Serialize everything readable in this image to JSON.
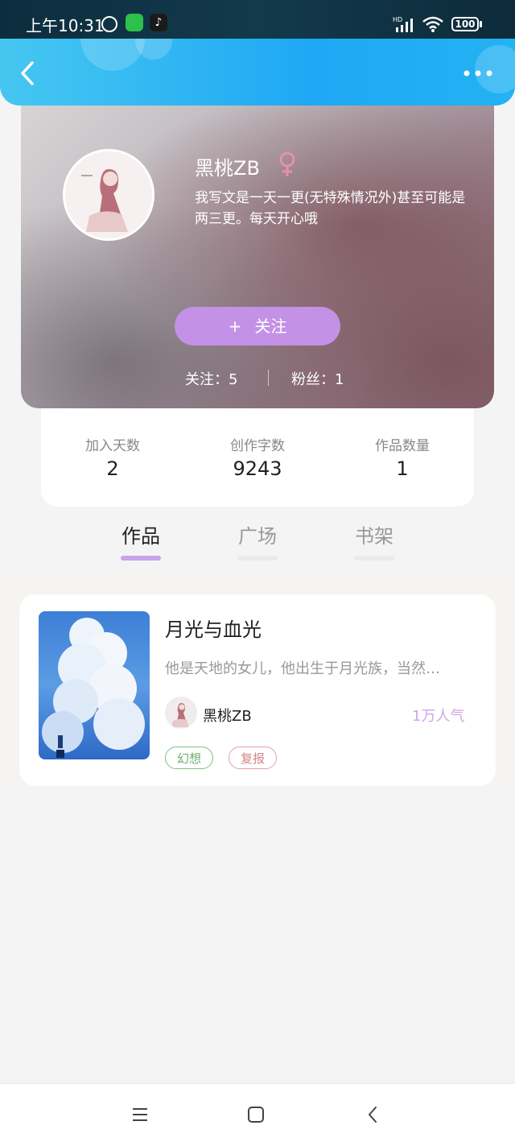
{
  "status_bar": {
    "time": "上午10:31",
    "battery": "100",
    "network": "HD",
    "icons": [
      "alarm-icon",
      "wechat-icon",
      "tiktok-icon",
      "signal-icon",
      "wifi-icon",
      "battery-icon"
    ]
  },
  "app_bar": {
    "back_icon": "chevron-left-icon",
    "more_icon": "more-dots-icon",
    "colors": {
      "start": "#46c7f1",
      "end": "#23b2f3"
    }
  },
  "profile": {
    "username": "黑桃ZB",
    "gender_symbol": "♀",
    "bio": "我写文是一天一更(无特殊情况外)甚至可能是两三更。每天开心哦",
    "follow_plus": "+",
    "follow_label": "关注",
    "following_text": "关注：5",
    "fans_text": "粉丝：1",
    "accent_color": "#c391e6"
  },
  "stats": {
    "items": [
      {
        "label": "加入天数",
        "value": "2"
      },
      {
        "label": "创作字数",
        "value": "9243"
      },
      {
        "label": "作品数量",
        "value": "1"
      }
    ]
  },
  "tabs": {
    "items": [
      {
        "label": "作品",
        "active": true
      },
      {
        "label": "广场",
        "active": false
      },
      {
        "label": "书架",
        "active": false
      }
    ]
  },
  "works": {
    "items": [
      {
        "title": "月光与血光",
        "description": "他是天地的女儿，他出生于月光族，当然…",
        "author": "黑桃ZB",
        "popularity": "1万人气",
        "tags": [
          "幻想",
          "复报"
        ]
      }
    ]
  },
  "nav_bar": {
    "icons": [
      "menu-icon",
      "home-icon",
      "back-icon"
    ]
  }
}
